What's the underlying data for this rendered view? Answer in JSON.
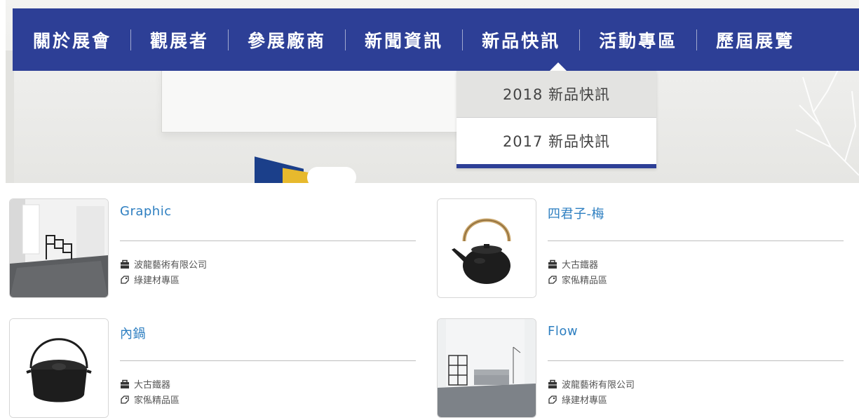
{
  "nav": {
    "items": [
      {
        "label": "關於展會"
      },
      {
        "label": "觀展者"
      },
      {
        "label": "參展廠商"
      },
      {
        "label": "新聞資訊"
      },
      {
        "label": "新品快訊"
      },
      {
        "label": "活動專區"
      },
      {
        "label": "歷屆展覽"
      }
    ],
    "active_index": 4
  },
  "dropdown": {
    "items": [
      {
        "label": "2018 新品快訊"
      },
      {
        "label": "2017 新品快訊"
      }
    ]
  },
  "products": [
    {
      "title": "Graphic",
      "company": "波龍藝術有限公司",
      "category": "綠建材專區",
      "image": "carpet-room-photo"
    },
    {
      "title": "四君子-梅",
      "company": "大古鐵器",
      "category": "家俬精品區",
      "image": "cast-iron-kettle-photo"
    },
    {
      "title": "內鍋",
      "company": "大古鐵器",
      "category": "家俬精品區",
      "image": "cast-iron-pot-photo"
    },
    {
      "title": "Flow",
      "company": "波龍藝術有限公司",
      "category": "綠建材專區",
      "image": "living-room-photo"
    }
  ],
  "colors": {
    "nav_bg": "#2d3f96",
    "title_link": "#2e7fc1",
    "dropdown_active_bg": "#e3e3e1"
  },
  "icons": {
    "company": "briefcase-icon",
    "category": "tag-icon"
  }
}
